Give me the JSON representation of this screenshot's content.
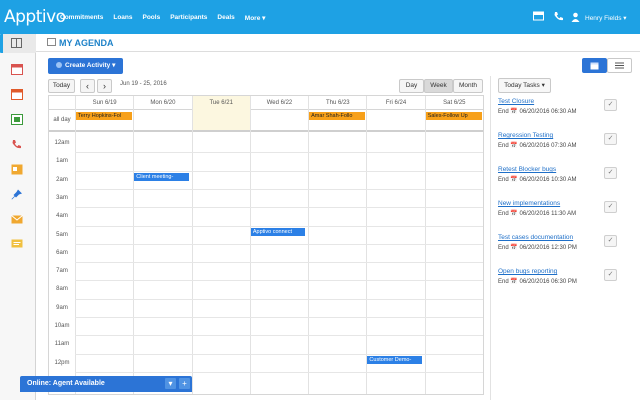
{
  "app": {
    "logo": "Apptivo"
  },
  "nav": [
    "Commitments",
    "Loans",
    "Pools",
    "Participants",
    "Deals",
    "More ▾"
  ],
  "user": {
    "name": "Henry Fields ▾"
  },
  "page": {
    "title": "MY AGENDA"
  },
  "toolbar": {
    "create_label": "Create Activity ▾",
    "today_label": "Today",
    "prev": "‹",
    "next": "›",
    "date_range": "Jun 19 - 25, 2016",
    "views": [
      "Day",
      "Week",
      "Month"
    ],
    "active_view": "Week"
  },
  "calendar": {
    "days": [
      "Sun 6/19",
      "Mon 6/20",
      "Tue 6/21",
      "Wed 6/22",
      "Thu 6/23",
      "Fri 6/24",
      "Sat 6/25"
    ],
    "today_index": 2,
    "allday_label": "all day",
    "hours": [
      "12am",
      "1am",
      "2am",
      "3am",
      "4am",
      "5am",
      "6am",
      "7am",
      "8am",
      "9am",
      "10am",
      "11am",
      "12pm"
    ],
    "allday_events": [
      {
        "day": 0,
        "label": "Terry Hopkins-Fol",
        "color": "#f7a01a"
      },
      {
        "day": 4,
        "label": "Amar Shah-Follo",
        "color": "#f7a01a"
      },
      {
        "day": 6,
        "label": "Sales-Follow Up",
        "color": "#f7a01a"
      }
    ],
    "timed_events": [
      {
        "day": 1,
        "hour": 2,
        "label": "Client meeting-",
        "color": "#2c80e6"
      },
      {
        "day": 3,
        "hour": 5,
        "label": "Apptivo connect",
        "color": "#2c80e6"
      },
      {
        "day": 5,
        "hour": 12,
        "label": "Customer Demo-",
        "color": "#2c80e6"
      }
    ]
  },
  "tasks": {
    "button_label": "Today Tasks ▾",
    "items": [
      {
        "title": "Test Closure",
        "end": "End 📅 06/20/2016 06:30 AM"
      },
      {
        "title": "Regression Testing",
        "end": "End 📅 06/20/2016 07:30 AM"
      },
      {
        "title": "Retest Blocker bugs",
        "end": "End 📅 06/20/2016 10:30 AM"
      },
      {
        "title": "New implementations",
        "end": "End 📅 06/20/2016 11:30 AM"
      },
      {
        "title": "Test cases documentation",
        "end": "End 📅 06/20/2016 12:30 PM"
      },
      {
        "title": "Open bugs reporting",
        "end": "End 📅 06/20/2016 06:30 PM"
      }
    ]
  },
  "chat": {
    "label": "Online: Agent Available",
    "minimize": "▾",
    "add": "+"
  },
  "colors": {
    "brand": "#1ea1e4",
    "primary": "#2c74d6",
    "allday": "#f7a01a",
    "event": "#2c80e6",
    "today": "#fcf7e0"
  }
}
